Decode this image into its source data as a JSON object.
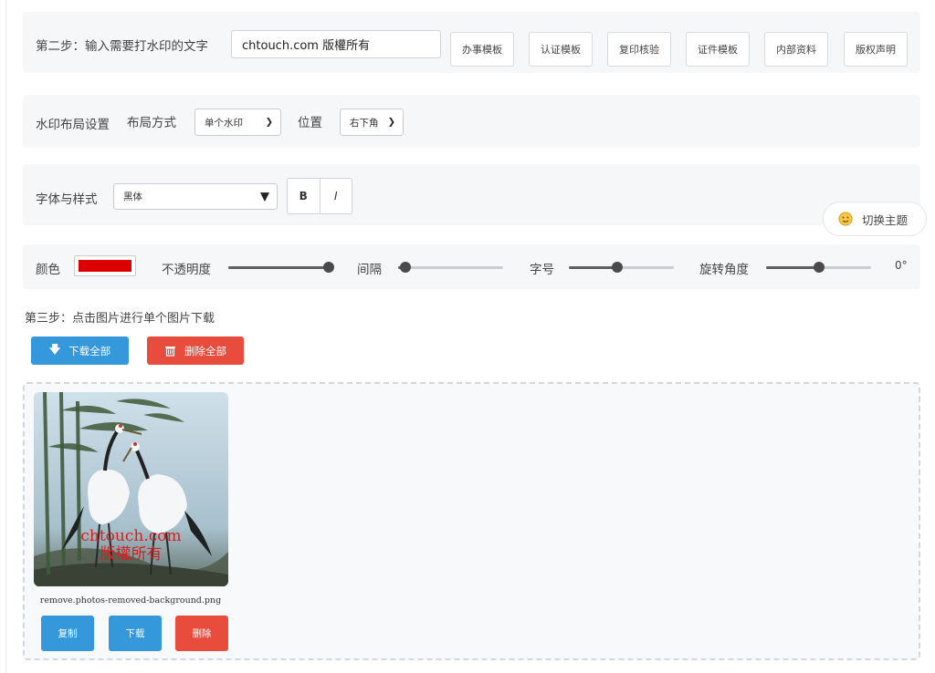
{
  "step2": {
    "label": "第二步：输入需要打水印的文字",
    "text_value": "chtouch.com 版權所有",
    "templates": [
      "办事模板",
      "认证模板",
      "复印核验",
      "证件模板",
      "内部资料",
      "版权声明"
    ]
  },
  "layout": {
    "label": "水印布局设置",
    "mode_label": "布局方式",
    "mode_value": "单个水印",
    "position_label": "位置",
    "position_value": "右下角"
  },
  "font": {
    "label": "字体与样式",
    "family_value": "黑体",
    "bold_label": "B",
    "italic_label": "I"
  },
  "theme_toggle": {
    "label": "切换主题"
  },
  "style": {
    "color_label": "颜色",
    "color_value": "#dd0000",
    "opacity_label": "不透明度",
    "opacity_value": 1.0,
    "spacing_label": "间隔",
    "spacing_value": 0.07,
    "fontsize_label": "字号",
    "fontsize_value": 0.46,
    "rotation_label": "旋转角度",
    "rotation_value": 0.5,
    "rotation_readout": "0°"
  },
  "step3": {
    "label": "第三步：点击图片进行单个图片下载",
    "download_all": "下载全部",
    "delete_all": "删除全部"
  },
  "result": {
    "watermark_line1": "chtouch.com",
    "watermark_line2": "版權所有",
    "filename": "remove.photos-removed-background.png",
    "copy_label": "复制",
    "download_label": "下载",
    "delete_label": "删除"
  },
  "colors": {
    "primary": "#3498db",
    "danger": "#e74c3c",
    "panel_bg": "#f5f7f9"
  }
}
